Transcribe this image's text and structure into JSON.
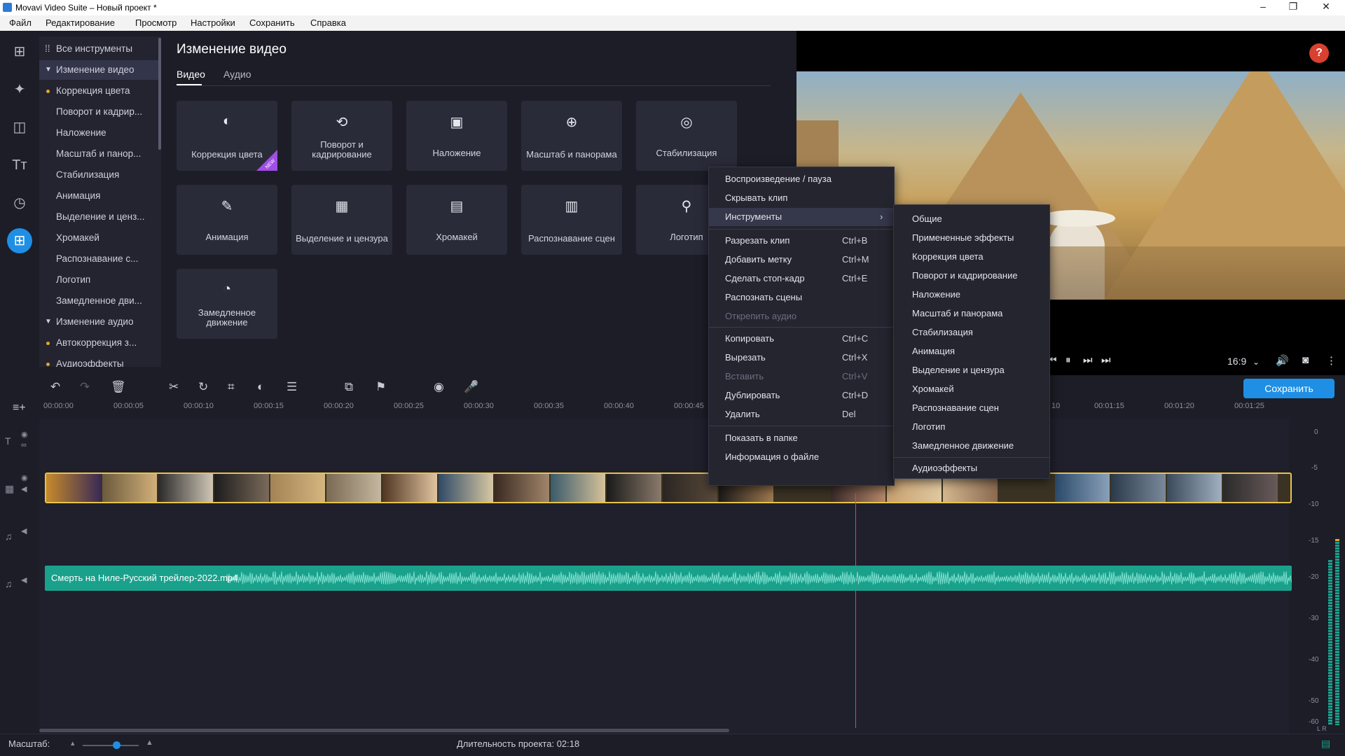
{
  "window": {
    "title": "Movavi Video Suite – Новый проект *"
  },
  "menubar": [
    "Файл",
    "Редактирование",
    "Просмотр",
    "Настройки",
    "Сохранить",
    "Справка"
  ],
  "sidebar": {
    "all_tools": "Все инструменты",
    "items": [
      {
        "label": "Изменение видео",
        "type": "group"
      },
      {
        "label": "Коррекция цвета",
        "type": "item",
        "dot": true
      },
      {
        "label": "Поворот и кадрир...",
        "type": "item"
      },
      {
        "label": "Наложение",
        "type": "item"
      },
      {
        "label": "Масштаб и панор...",
        "type": "item"
      },
      {
        "label": "Стабилизация",
        "type": "item"
      },
      {
        "label": "Анимация",
        "type": "item"
      },
      {
        "label": "Выделение и ценз...",
        "type": "item"
      },
      {
        "label": "Хромакей",
        "type": "item"
      },
      {
        "label": "Распознавание с...",
        "type": "item"
      },
      {
        "label": "Логотип",
        "type": "item"
      },
      {
        "label": "Замедленное дви...",
        "type": "item"
      },
      {
        "label": "Изменение аудио",
        "type": "group"
      },
      {
        "label": "Автокоррекция з...",
        "type": "item",
        "dot": true
      },
      {
        "label": "Аудиоэффекты",
        "type": "item",
        "dot": true
      }
    ]
  },
  "panel": {
    "title": "Изменение видео",
    "tabs": [
      "Видео",
      "Аудио"
    ],
    "cards": [
      {
        "label": "Коррекция цвета",
        "icon": "◐",
        "badge": "NEW"
      },
      {
        "label": "Поворот и кадрирование",
        "icon": "⟲"
      },
      {
        "label": "Наложение",
        "icon": "▣"
      },
      {
        "label": "Масштаб и панорама",
        "icon": "⊕"
      },
      {
        "label": "Стабилизация",
        "icon": "◎"
      },
      {
        "label": "Анимация",
        "icon": "✎"
      },
      {
        "label": "Выделение и цензура",
        "icon": "▦"
      },
      {
        "label": "Хромакей",
        "icon": "▤"
      },
      {
        "label": "Распознавание сцен",
        "icon": "▥"
      },
      {
        "label": "Логотип",
        "icon": "⚲"
      },
      {
        "label": "Замедленное движение",
        "icon": "◔"
      }
    ]
  },
  "preview": {
    "ratio": "16:9",
    "save_label": "Сохранить",
    "help": "?"
  },
  "timeline": {
    "ruler": [
      "00:00:00",
      "00:00:05",
      "00:00:10",
      "00:00:15",
      "00:00:20",
      "00:00:25",
      "00:00:30",
      "00:00:35",
      "00:00:40",
      "00:00:45",
      "10",
      "00:01:15",
      "00:01:20",
      "00:01:25"
    ],
    "audio_clip": "Смерть на Ниле-Русский трейлер-2022.mp4",
    "meter_labels": [
      "0",
      "-5",
      "-10",
      "-15",
      "-20",
      "-30",
      "-40",
      "-50",
      "-60"
    ],
    "meter_lr": "L R"
  },
  "status": {
    "scale_label": "Масштаб:",
    "duration": "Длительность проекта:  02:18"
  },
  "context_menu": [
    {
      "label": "Воспроизведение / пауза",
      "key": ""
    },
    {
      "label": "Скрывать клип",
      "key": ""
    },
    {
      "label": "Инструменты",
      "key": "",
      "submenu": true
    },
    {
      "sep": true
    },
    {
      "label": "Разрезать клип",
      "key": "Ctrl+B"
    },
    {
      "label": "Добавить метку",
      "key": "Ctrl+M"
    },
    {
      "label": "Сделать стоп-кадр",
      "key": "Ctrl+E"
    },
    {
      "label": "Распознать сцены",
      "key": ""
    },
    {
      "label": "Открепить аудио",
      "key": "",
      "disabled": true
    },
    {
      "sep": true
    },
    {
      "label": "Копировать",
      "key": "Ctrl+C"
    },
    {
      "label": "Вырезать",
      "key": "Ctrl+X"
    },
    {
      "label": "Вставить",
      "key": "Ctrl+V",
      "disabled": true
    },
    {
      "label": "Дублировать",
      "key": "Ctrl+D"
    },
    {
      "label": "Удалить",
      "key": "Del"
    },
    {
      "sep": true
    },
    {
      "label": "Показать в папке",
      "key": ""
    },
    {
      "label": "Информация о файле",
      "key": ""
    }
  ],
  "submenu": [
    "Общие",
    "Примененные эффекты",
    "Коррекция цвета",
    "Поворот и кадрирование",
    "Наложение",
    "Масштаб и панорама",
    "Стабилизация",
    "Анимация",
    "Выделение и цензура",
    "Хромакей",
    "Распознавание сцен",
    "Логотип",
    "Замедленное движение",
    "Аудиоэффекты"
  ],
  "colors": {
    "accent": "#1f8fe5",
    "clip_border": "#e9c34a",
    "audio": "#1aa18c",
    "playhead": "#e04a4a"
  }
}
